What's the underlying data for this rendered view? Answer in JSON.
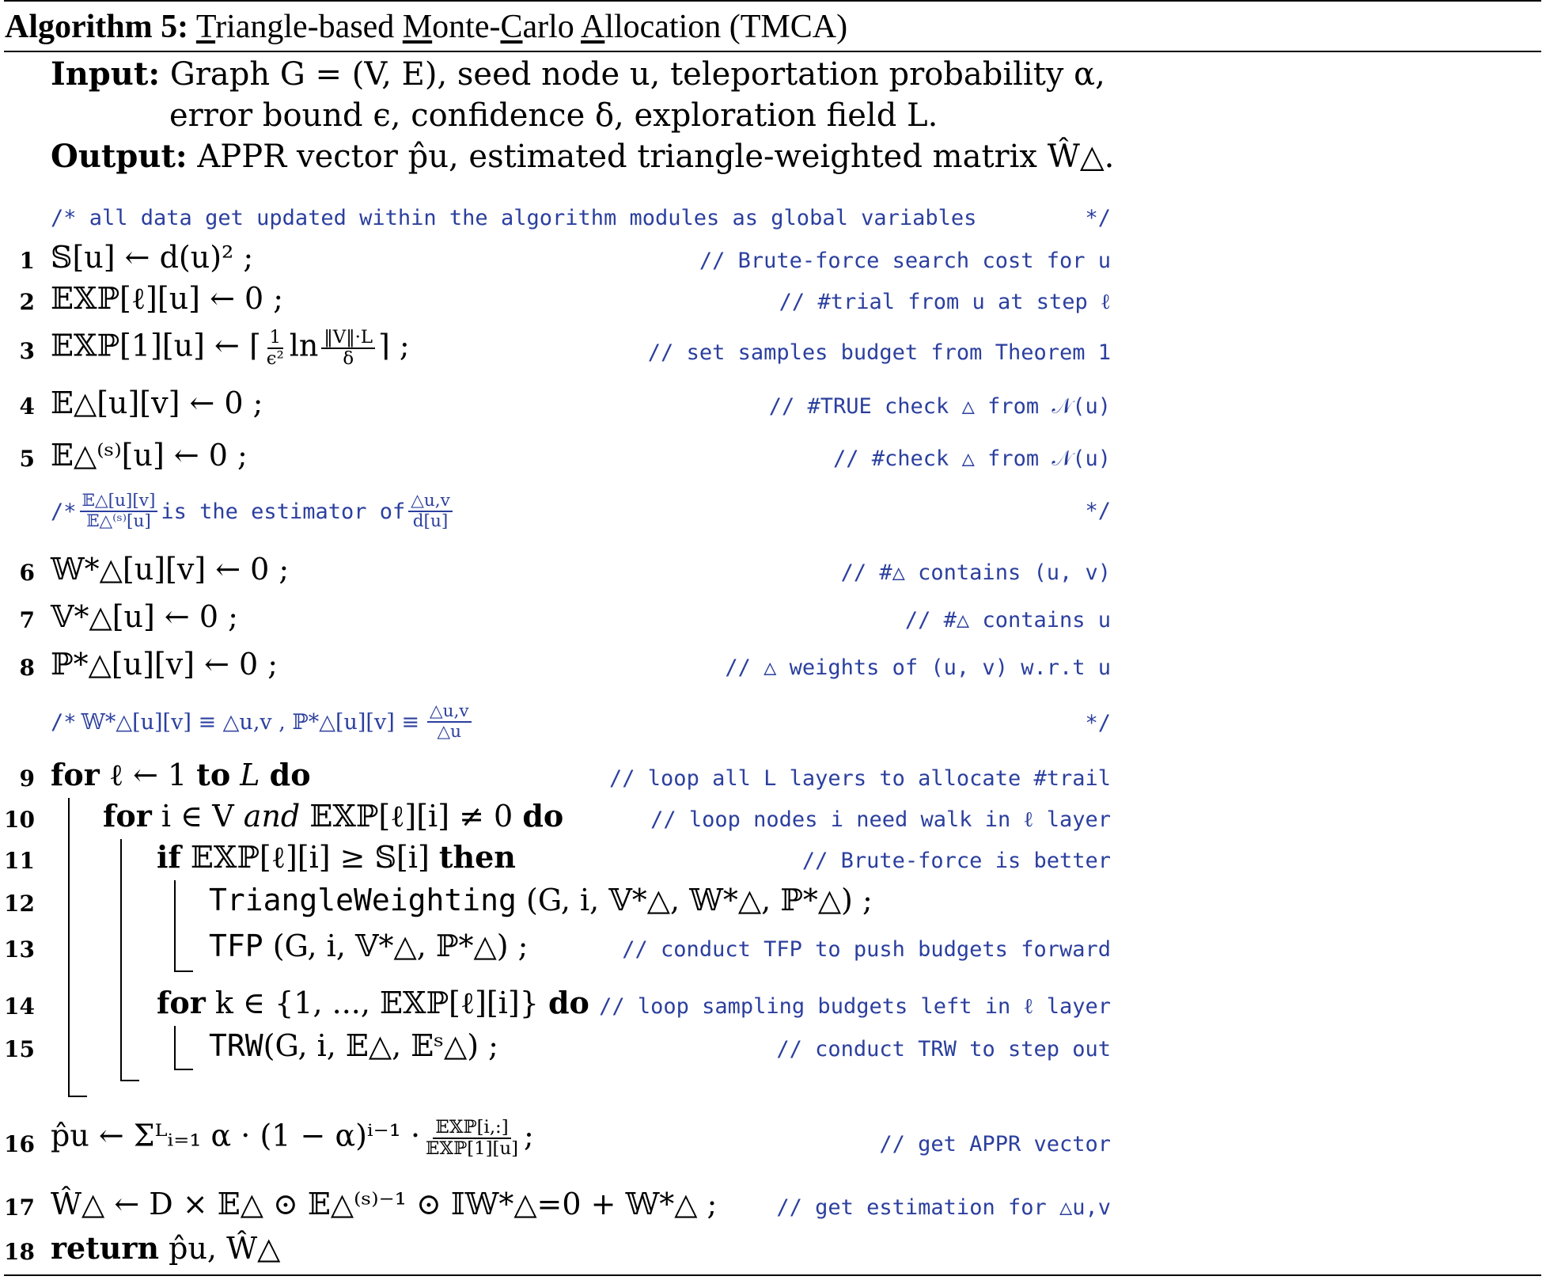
{
  "algorithm": {
    "label": "Algorithm 5:",
    "name_parts": [
      "T",
      "riangle-based ",
      "M",
      "onte-",
      "C",
      "arlo ",
      "A",
      "llocation (TMCA)"
    ],
    "input_label": "Input:",
    "input_line1": "Graph G = (V, E), seed node u, teleportation probability α,",
    "input_line2": "error bound ϵ, confidence δ, exploration field L.",
    "output_label": "Output:",
    "output_text": "APPR vector p̂u, estimated triangle-weighted matrix Ŵ△."
  },
  "header_comment": "/* all data get updated within the algorithm modules as global variables",
  "header_comment_end": "*/",
  "lines": [
    {
      "n": "1",
      "stmt": "𝕊[u] ← d(u)² ;",
      "comment": "// Brute-force search cost for u"
    },
    {
      "n": "2",
      "stmt": "𝔼𝕏ℙ[ℓ][u] ← 0 ;",
      "comment": "// #trial from u at step ℓ"
    },
    {
      "n": "3",
      "stmt_pre": "𝔼𝕏ℙ[1][u] ← ⌈",
      "frac1_num": "1",
      "frac1_den": "ϵ²",
      "stmt_mid": "ln",
      "frac2_num": "‖V‖·L",
      "frac2_den": "δ",
      "stmt_post": "⌉ ;",
      "comment": "// set samples budget from Theorem 1"
    },
    {
      "n": "4",
      "stmt": "𝔼△[u][v] ← 0 ;",
      "comment": "// #TRUE check △ from 𝒩(u)"
    },
    {
      "n": "5",
      "stmt": "𝔼△⁽ˢ⁾[u] ← 0 ;",
      "comment": "// #check △ from 𝒩(u)"
    },
    {
      "n": "6",
      "stmt": "𝕎*△[u][v] ← 0 ;",
      "comment": "// #△ contains (u, v)"
    },
    {
      "n": "7",
      "stmt": "𝕍*△[u] ← 0 ;",
      "comment": "// #△ contains u"
    },
    {
      "n": "8",
      "stmt": "ℙ*△[u][v] ← 0 ;",
      "comment": "// △ weights of (u, v) w.r.t u"
    },
    {
      "n": "9",
      "kw1": "for",
      "stmt": "ℓ ← 1",
      "kw2": "to",
      "stmt2": "L",
      "kw3": "do",
      "comment": "// loop all L layers to allocate #trail"
    },
    {
      "n": "10",
      "kw1": "for",
      "stmt": "i ∈ V",
      "stmt_it": "and",
      "stmt2": "𝔼𝕏ℙ[ℓ][i] ≠ 0",
      "kw3": "do",
      "comment": "// loop nodes i need walk in ℓ layer"
    },
    {
      "n": "11",
      "kw1": "if",
      "stmt": "𝔼𝕏ℙ[ℓ][i] ≥ 𝕊[i]",
      "kw3": "then",
      "comment": "// Brute-force is better"
    },
    {
      "n": "12",
      "code": "TriangleWeighting",
      "stmt": "(G, i, 𝕍*△, 𝕎*△, ℙ*△) ;",
      "comment": ""
    },
    {
      "n": "13",
      "code": "TFP",
      "stmt": "(G, i, 𝕍*△, ℙ*△) ;",
      "comment": "// conduct TFP to push budgets forward"
    },
    {
      "n": "14",
      "kw1": "for",
      "stmt": "k ∈ {1, ..., 𝔼𝕏ℙ[ℓ][i]}",
      "kw3": "do",
      "comment": "// loop sampling budgets left in ℓ layer"
    },
    {
      "n": "15",
      "code": "TRW",
      "stmt": "(G, i, 𝔼△, 𝔼ˢ△) ;",
      "comment": "// conduct TRW to step out"
    },
    {
      "n": "16",
      "stmt_pre": "p̂u ← Σᴸᵢ₌₁ α · (1 − α)ⁱ⁻¹ ·",
      "frac1_num": "𝔼𝕏ℙ[i,:]",
      "frac1_den": "𝔼𝕏ℙ[1][u]",
      "stmt_post": ";",
      "comment": "// get APPR vector"
    },
    {
      "n": "17",
      "stmt": "Ŵ△ ← D × 𝔼△ ⊙ 𝔼△⁽ˢ⁾⁻¹ ⊙ 𝕀𝕎*△=0 + 𝕎*△ ;",
      "comment": "// get estimation for △u,v"
    },
    {
      "n": "18",
      "kw1": "return",
      "stmt": "p̂u, Ŵ△",
      "comment": ""
    }
  ],
  "mid_comment1": {
    "pre": "/*",
    "frac_num": "𝔼△[u][v]",
    "frac_den": "𝔼△⁽ˢ⁾[u]",
    "mid": "is the estimator of",
    "frac2_num": "△u,v",
    "frac2_den": "d[u]",
    "end": "*/"
  },
  "mid_comment2": {
    "pre": "/*",
    "text": "𝕎*△[u][v] ≡ △u,v ,  ℙ*△[u][v] ≡",
    "frac_num": "△u,v",
    "frac_den": "△u",
    "end": "*/"
  }
}
